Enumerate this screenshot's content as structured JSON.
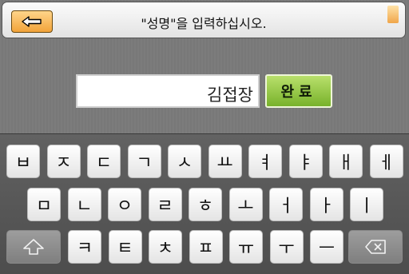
{
  "header": {
    "title": "\"성명\"을 입력하십시오.",
    "back_icon": "left-arrow-icon"
  },
  "input": {
    "value": "김접장"
  },
  "done_button": {
    "label": "완료"
  },
  "keyboard": {
    "row1": [
      "ㅂ",
      "ㅈ",
      "ㄷ",
      "ㄱ",
      "ㅅ",
      "ㅛ",
      "ㅕ",
      "ㅑ",
      "ㅐ",
      "ㅔ"
    ],
    "row2": [
      "ㅁ",
      "ㄴ",
      "ㅇ",
      "ㄹ",
      "ㅎ",
      "ㅗ",
      "ㅓ",
      "ㅏ",
      "ㅣ"
    ],
    "row3": [
      "ㅋ",
      "ㅌ",
      "ㅊ",
      "ㅍ",
      "ㅠ",
      "ㅜ",
      "ㅡ"
    ],
    "shift_icon": "shift-arrow-icon",
    "backspace_icon": "backspace-icon"
  },
  "colors": {
    "back_button": "#f2a33a",
    "done_button": "#8cc63f",
    "background": "#7a7a7a"
  }
}
